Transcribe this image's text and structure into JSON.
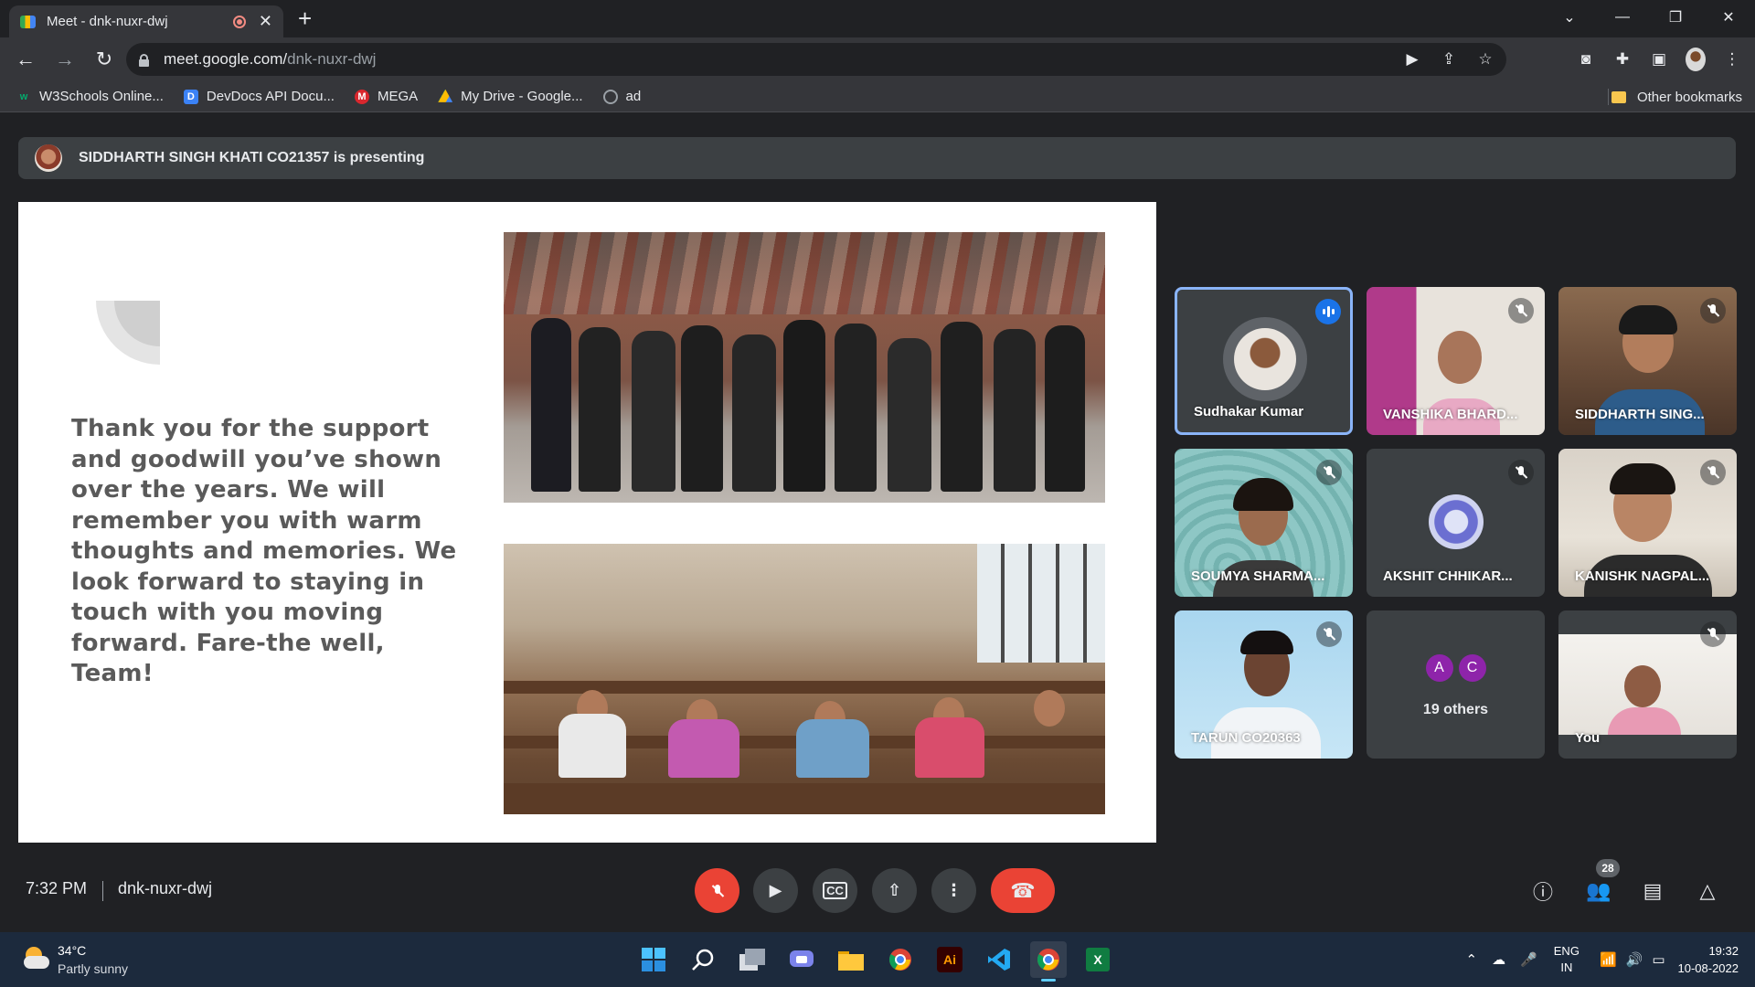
{
  "browser": {
    "tab_title": "Meet - dnk-nuxr-dwj",
    "tab_close": "✕",
    "new_tab": "+",
    "url_host": "meet.google.com/",
    "url_path": "dnk-nuxr-dwj",
    "bookmarks": [
      {
        "label": "W3Schools Online...",
        "icon": "w3schools-icon",
        "color": "#04aa6d"
      },
      {
        "label": "DevDocs API Docu...",
        "icon": "devdocs-icon",
        "color": "#3b82f6"
      },
      {
        "label": "MEGA",
        "icon": "mega-icon",
        "color": "#d9272e"
      },
      {
        "label": "My Drive - Google...",
        "icon": "google-drive-icon",
        "color": "#fbbc04"
      },
      {
        "label": "ad",
        "icon": "globe-icon",
        "color": "#9aa0a6"
      }
    ],
    "other_bookmarks": "Other bookmarks"
  },
  "meet": {
    "presenter_banner": "SIDDHARTH SINGH KHATI CO21357 is presenting",
    "slide_text": "Thank you for the support and goodwill you’ve shown over the years. We will remember you with warm thoughts and memories. We look forward to staying in touch with you moving forward. Fare-the well, Team!",
    "participants": [
      {
        "name": "Sudhakar Kumar",
        "state": "speaking"
      },
      {
        "name": "VANSHIKA BHARD...",
        "state": "muted"
      },
      {
        "name": "SIDDHARTH SING...",
        "state": "muted"
      },
      {
        "name": "SOUMYA SHARMA...",
        "state": "muted"
      },
      {
        "name": "AKSHIT CHHIKAR...",
        "state": "muted"
      },
      {
        "name": "KANISHK NAGPAL...",
        "state": "muted"
      },
      {
        "name": "TARUN CO20363",
        "state": "muted"
      },
      {
        "name": "You",
        "state": "muted"
      }
    ],
    "others": {
      "avatars": [
        "A",
        "C"
      ],
      "label": "19 others"
    },
    "time": "7:32 PM",
    "meeting_code": "dnk-nuxr-dwj",
    "participant_count": "28",
    "accent": "#8ab4f8",
    "end_call_color": "#ea4335"
  },
  "taskbar": {
    "temperature": "34°C",
    "weather": "Partly sunny",
    "language_top": "ENG",
    "language_bottom": "IN",
    "time": "19:32",
    "date": "10-08-2022",
    "apps": [
      "windows-start-icon",
      "search-icon",
      "task-view-icon",
      "teams-chat-icon",
      "file-explorer-icon",
      "chrome-icon",
      "illustrator-icon",
      "vscode-icon",
      "chrome-icon",
      "excel-icon"
    ],
    "illustrator_label": "Ai",
    "excel_label": "X"
  }
}
